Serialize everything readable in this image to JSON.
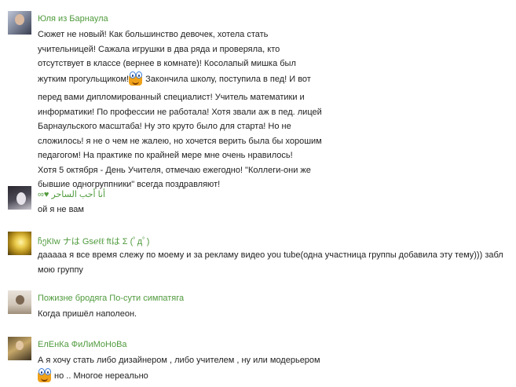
{
  "comments": [
    {
      "author": "Юля из Барнаула",
      "line1": "Сюжет не новый! Как большинство девочек, хотела стать",
      "line2": "учительницей! Сажала игрушки в два ряда и проверяла, кто",
      "line3": "отсутствует в классе (вернее в комнате)! Косолапый мишка был",
      "line4a": "жутким прогульщиком!",
      "line4b": " Закончила школу, поступила в пед! И вот",
      "line5": "перед вами дипломированный специалист! Учитель математики и",
      "line6": "информатики! По профессии не работала! Хотя звали аж в пед. лицей",
      "line7": "Барнаульского масштаба! Ну это круто было для старта! Но не",
      "line8": "сложилось! я не о чем не жалею, но хочется верить была бы хорошим",
      "line9": "педагогом! На практике по крайней мере мне очень нравилось!",
      "line10": "Хотя 5 октября - День Учителя, отмечаю ежегодно! \"Коллеги-они же",
      "line11": "бывшие одногруппники\" всегда поздравляют!"
    },
    {
      "author": "∞♥ أنا أحب الساحر",
      "text": "ой я не вам"
    },
    {
      "author": "ჩეКIw ナは Gѕℯℓℓ  ftは Σ (ﾟдﾟ)",
      "line1": "дааааа я все время слежу по моему и за рекламу видео you tube(одна участница группы добавила эту тему))) забл",
      "line2": "мою группу"
    },
    {
      "author": "Пожизне бродяга По-сути симпатяга",
      "text": "Когда пришёл наполеон."
    },
    {
      "author": "ЕлЕнКа ФиЛиМоНоВа",
      "line1": "А я хочу стать либо дизайнером , либо учителем , ну или модерьером",
      "line2": " но .. Многое нереально"
    }
  ],
  "icons": {
    "smiley": "smiley-emoticon-icon"
  }
}
